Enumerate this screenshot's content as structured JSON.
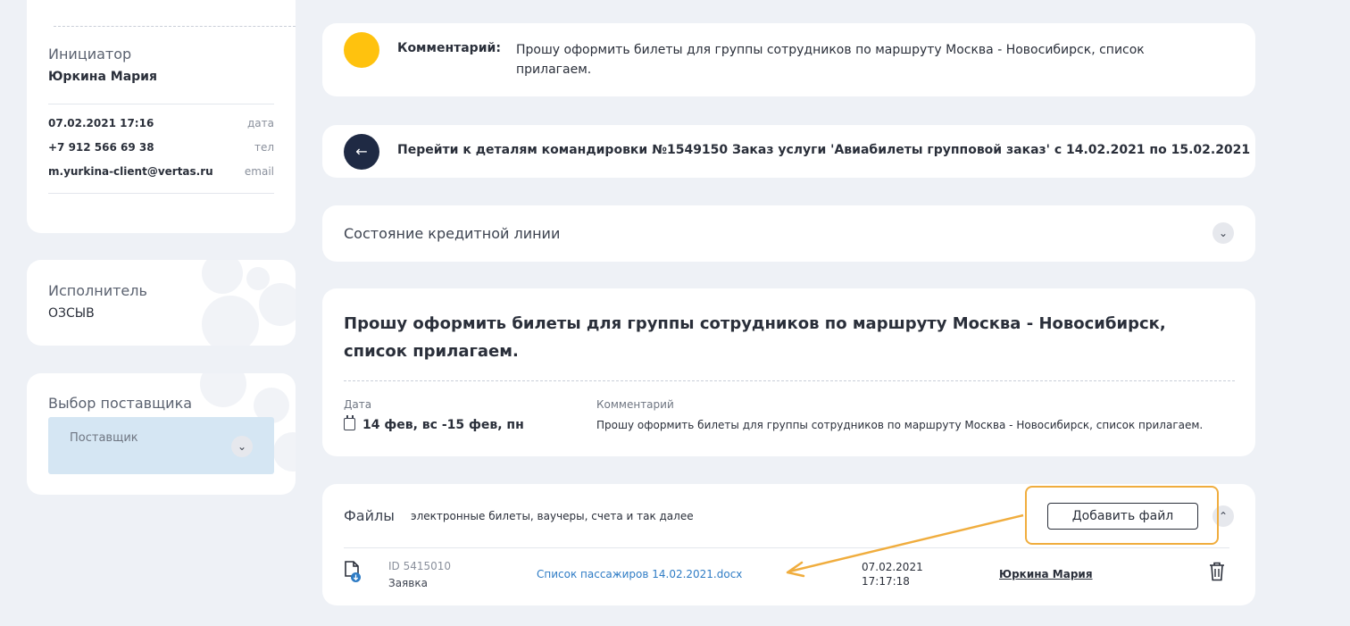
{
  "initiator": {
    "label": "Инициатор",
    "name": "Юркина Мария",
    "rows": [
      {
        "value": "07.02.2021 17:16",
        "key": "дата"
      },
      {
        "value": "+7 912 566 69 38",
        "key": "тел"
      },
      {
        "value": "m.yurkina-client@vertas.ru",
        "key": "email"
      }
    ]
  },
  "executor": {
    "label": "Исполнитель",
    "name": "ОЗСЫВ"
  },
  "supplier": {
    "label": "Выбор поставщика",
    "placeholder": "Поставщик"
  },
  "comment_card": {
    "key": "Комментарий:",
    "text": "Прошу оформить билеты для группы сотрудников по маршруту Москва - Новосибирск, список прилагаем."
  },
  "trip_link": {
    "text": "Перейти к деталям командировки №1549150 Заказ услуги 'Авиабилеты групповой заказ' с 14.02.2021 по 15.02.2021"
  },
  "credit": {
    "title": "Состояние кредитной линии"
  },
  "details": {
    "title": "Прошу оформить билеты для группы сотрудников по маршруту Москва - Новосибирск, список прилагаем.",
    "date_label": "Дата",
    "date_value": "14 фев, вс -15 фев, пн",
    "comment_label": "Комментарий",
    "comment_value": "Прошу оформить билеты для группы сотрудников по маршруту Москва - Новосибирск, список прилагаем."
  },
  "files": {
    "title": "Файлы",
    "hint": "электронные билеты, ваучеры, счета и так далее",
    "add_button": "Добавить файл",
    "items": [
      {
        "id": "ID 5415010",
        "type": "Заявка",
        "name": "Список пассажиров 14.02.2021.docx",
        "date": "07.02.2021",
        "time": "17:17:18",
        "user": "Юркина Мария"
      }
    ]
  },
  "colors": {
    "accent_yellow": "#ffc20e",
    "dark_navy": "#1f2a44",
    "link_blue": "#2f7cc5",
    "highlight_orange": "#f0ad3e",
    "select_bg": "#d5e6f3"
  }
}
